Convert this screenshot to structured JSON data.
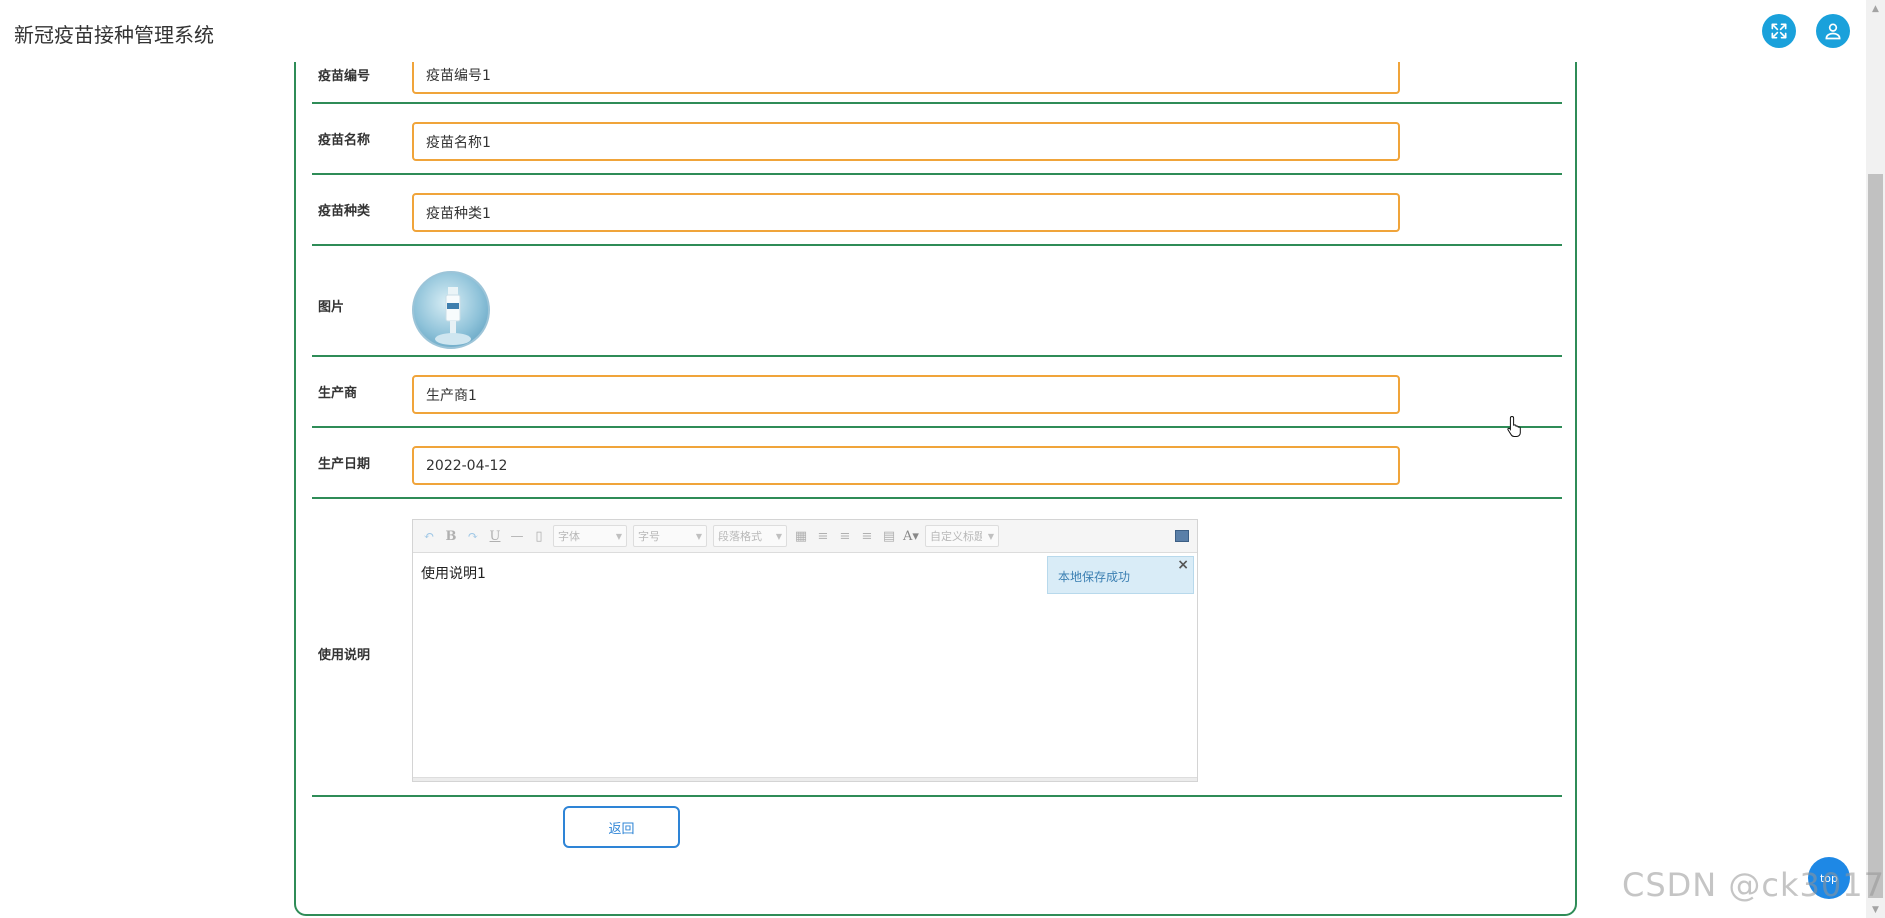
{
  "app": {
    "title": "新冠疫苗接种管理系统"
  },
  "header": {
    "fullscreen_icon": "fullscreen-icon",
    "user_icon": "user-icon"
  },
  "form": {
    "fields": [
      {
        "label": "疫苗编号",
        "value": "疫苗编号1"
      },
      {
        "label": "疫苗名称",
        "value": "疫苗名称1"
      },
      {
        "label": "疫苗种类",
        "value": "疫苗种类1"
      },
      {
        "label": "图片"
      },
      {
        "label": "生产商",
        "value": "生产商1"
      },
      {
        "label": "生产日期",
        "value": "2022-04-12"
      },
      {
        "label": "使用说明"
      }
    ],
    "editor": {
      "toolbar": {
        "font_family": "字体",
        "font_size": "字号",
        "paragraph": "段落格式",
        "custom_title": "自定义标题"
      },
      "content": "使用说明1",
      "toast": "本地保存成功"
    },
    "back_label": "返回"
  },
  "float_button": {
    "label": "top"
  },
  "watermark": "CSDN @ck3017",
  "colors": {
    "accent": "#1aa1db",
    "border_green": "#2f8c57",
    "input_orange": "#f0a43a",
    "button_blue": "#2e84d6"
  }
}
